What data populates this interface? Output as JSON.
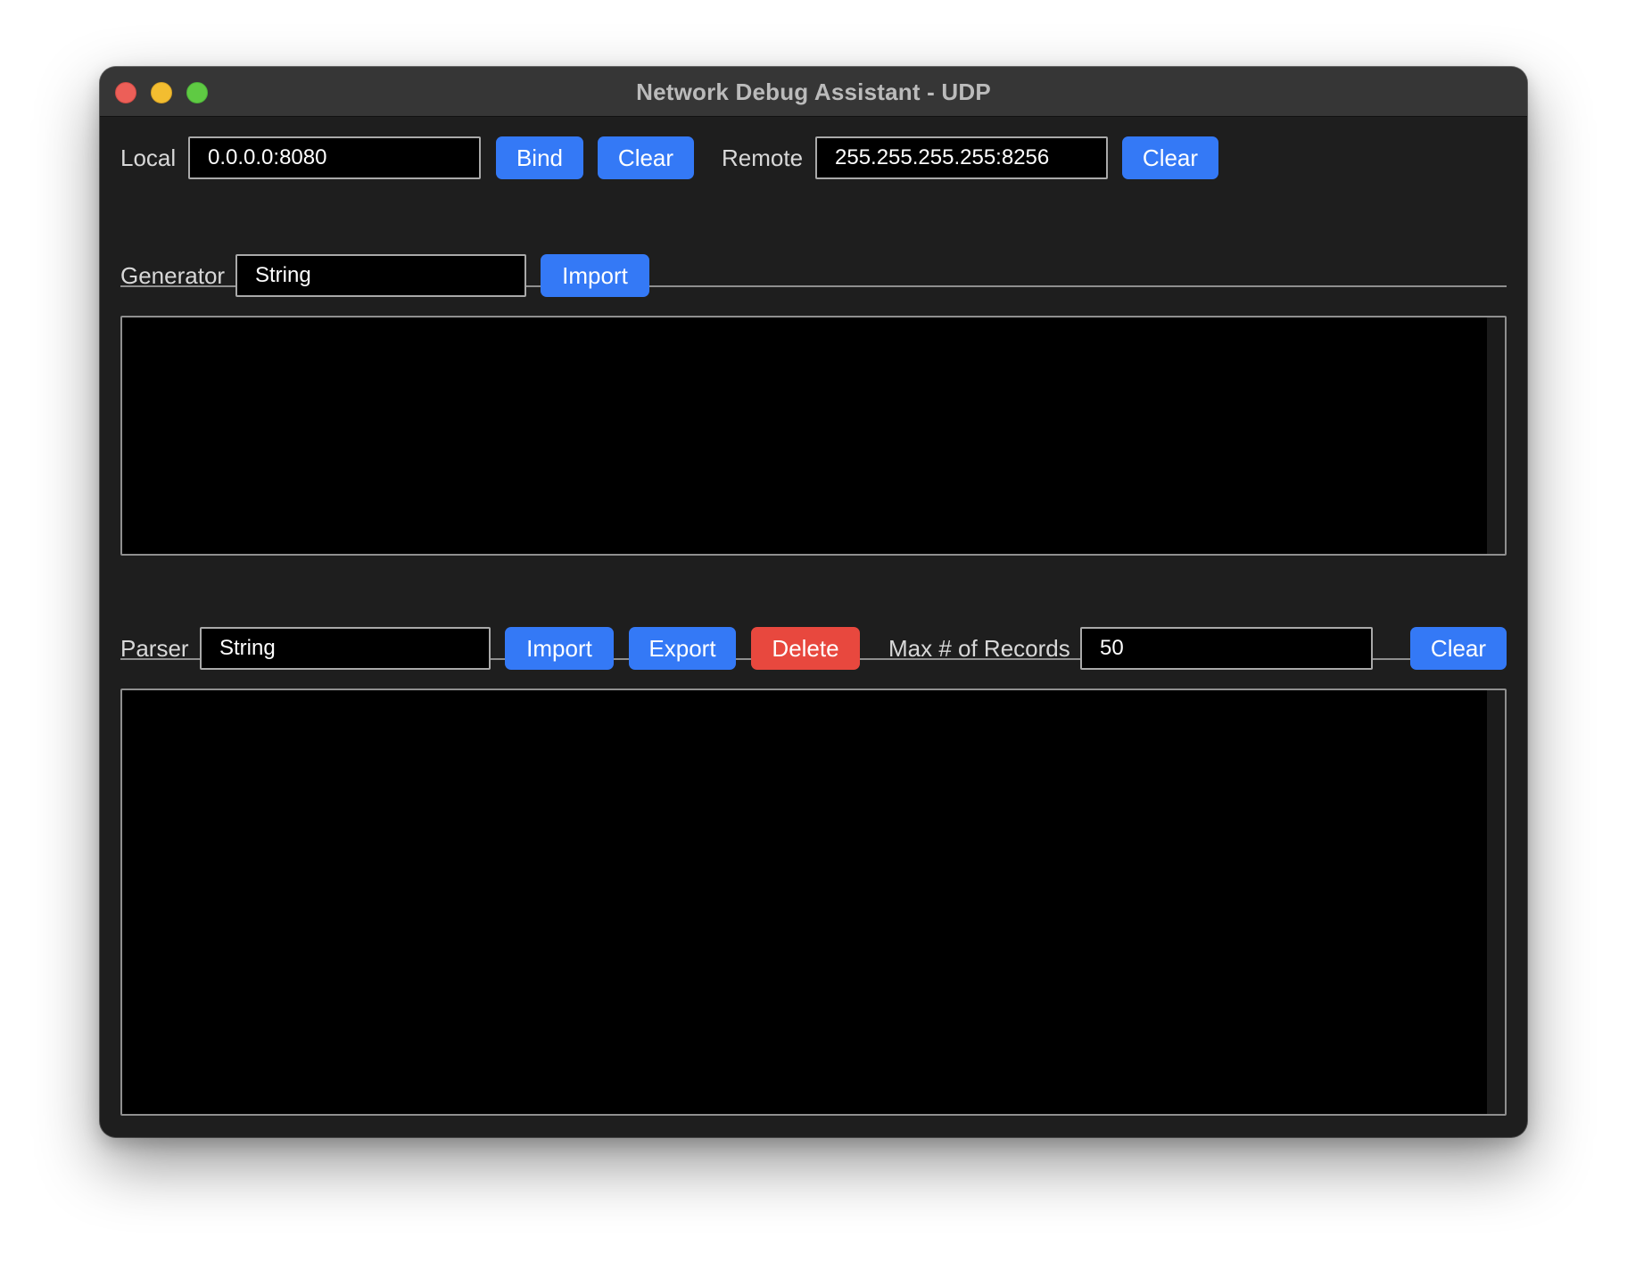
{
  "window": {
    "title": "Network Debug Assistant - UDP",
    "controls": [
      "close-icon",
      "minimize-icon",
      "zoom-icon"
    ]
  },
  "connection": {
    "local_label": "Local",
    "local_value": "0.0.0.0:8080",
    "bind_label": "Bind",
    "local_clear_label": "Clear",
    "remote_label": "Remote",
    "remote_value": "255.255.255.255:8256",
    "remote_clear_label": "Clear"
  },
  "generator": {
    "label": "Generator",
    "type_value": "String",
    "import_label": "Import",
    "content": ""
  },
  "parser": {
    "label": "Parser",
    "type_value": "String",
    "import_label": "Import",
    "export_label": "Export",
    "delete_label": "Delete",
    "max_records_label": "Max # of Records",
    "max_records_value": "50",
    "clear_label": "Clear",
    "content": ""
  },
  "colors": {
    "accent": "#3479f6",
    "danger": "#e8483e",
    "window_bg": "#1e1e1e",
    "field_bg": "#000000",
    "titlebar_bg": "#363636"
  }
}
